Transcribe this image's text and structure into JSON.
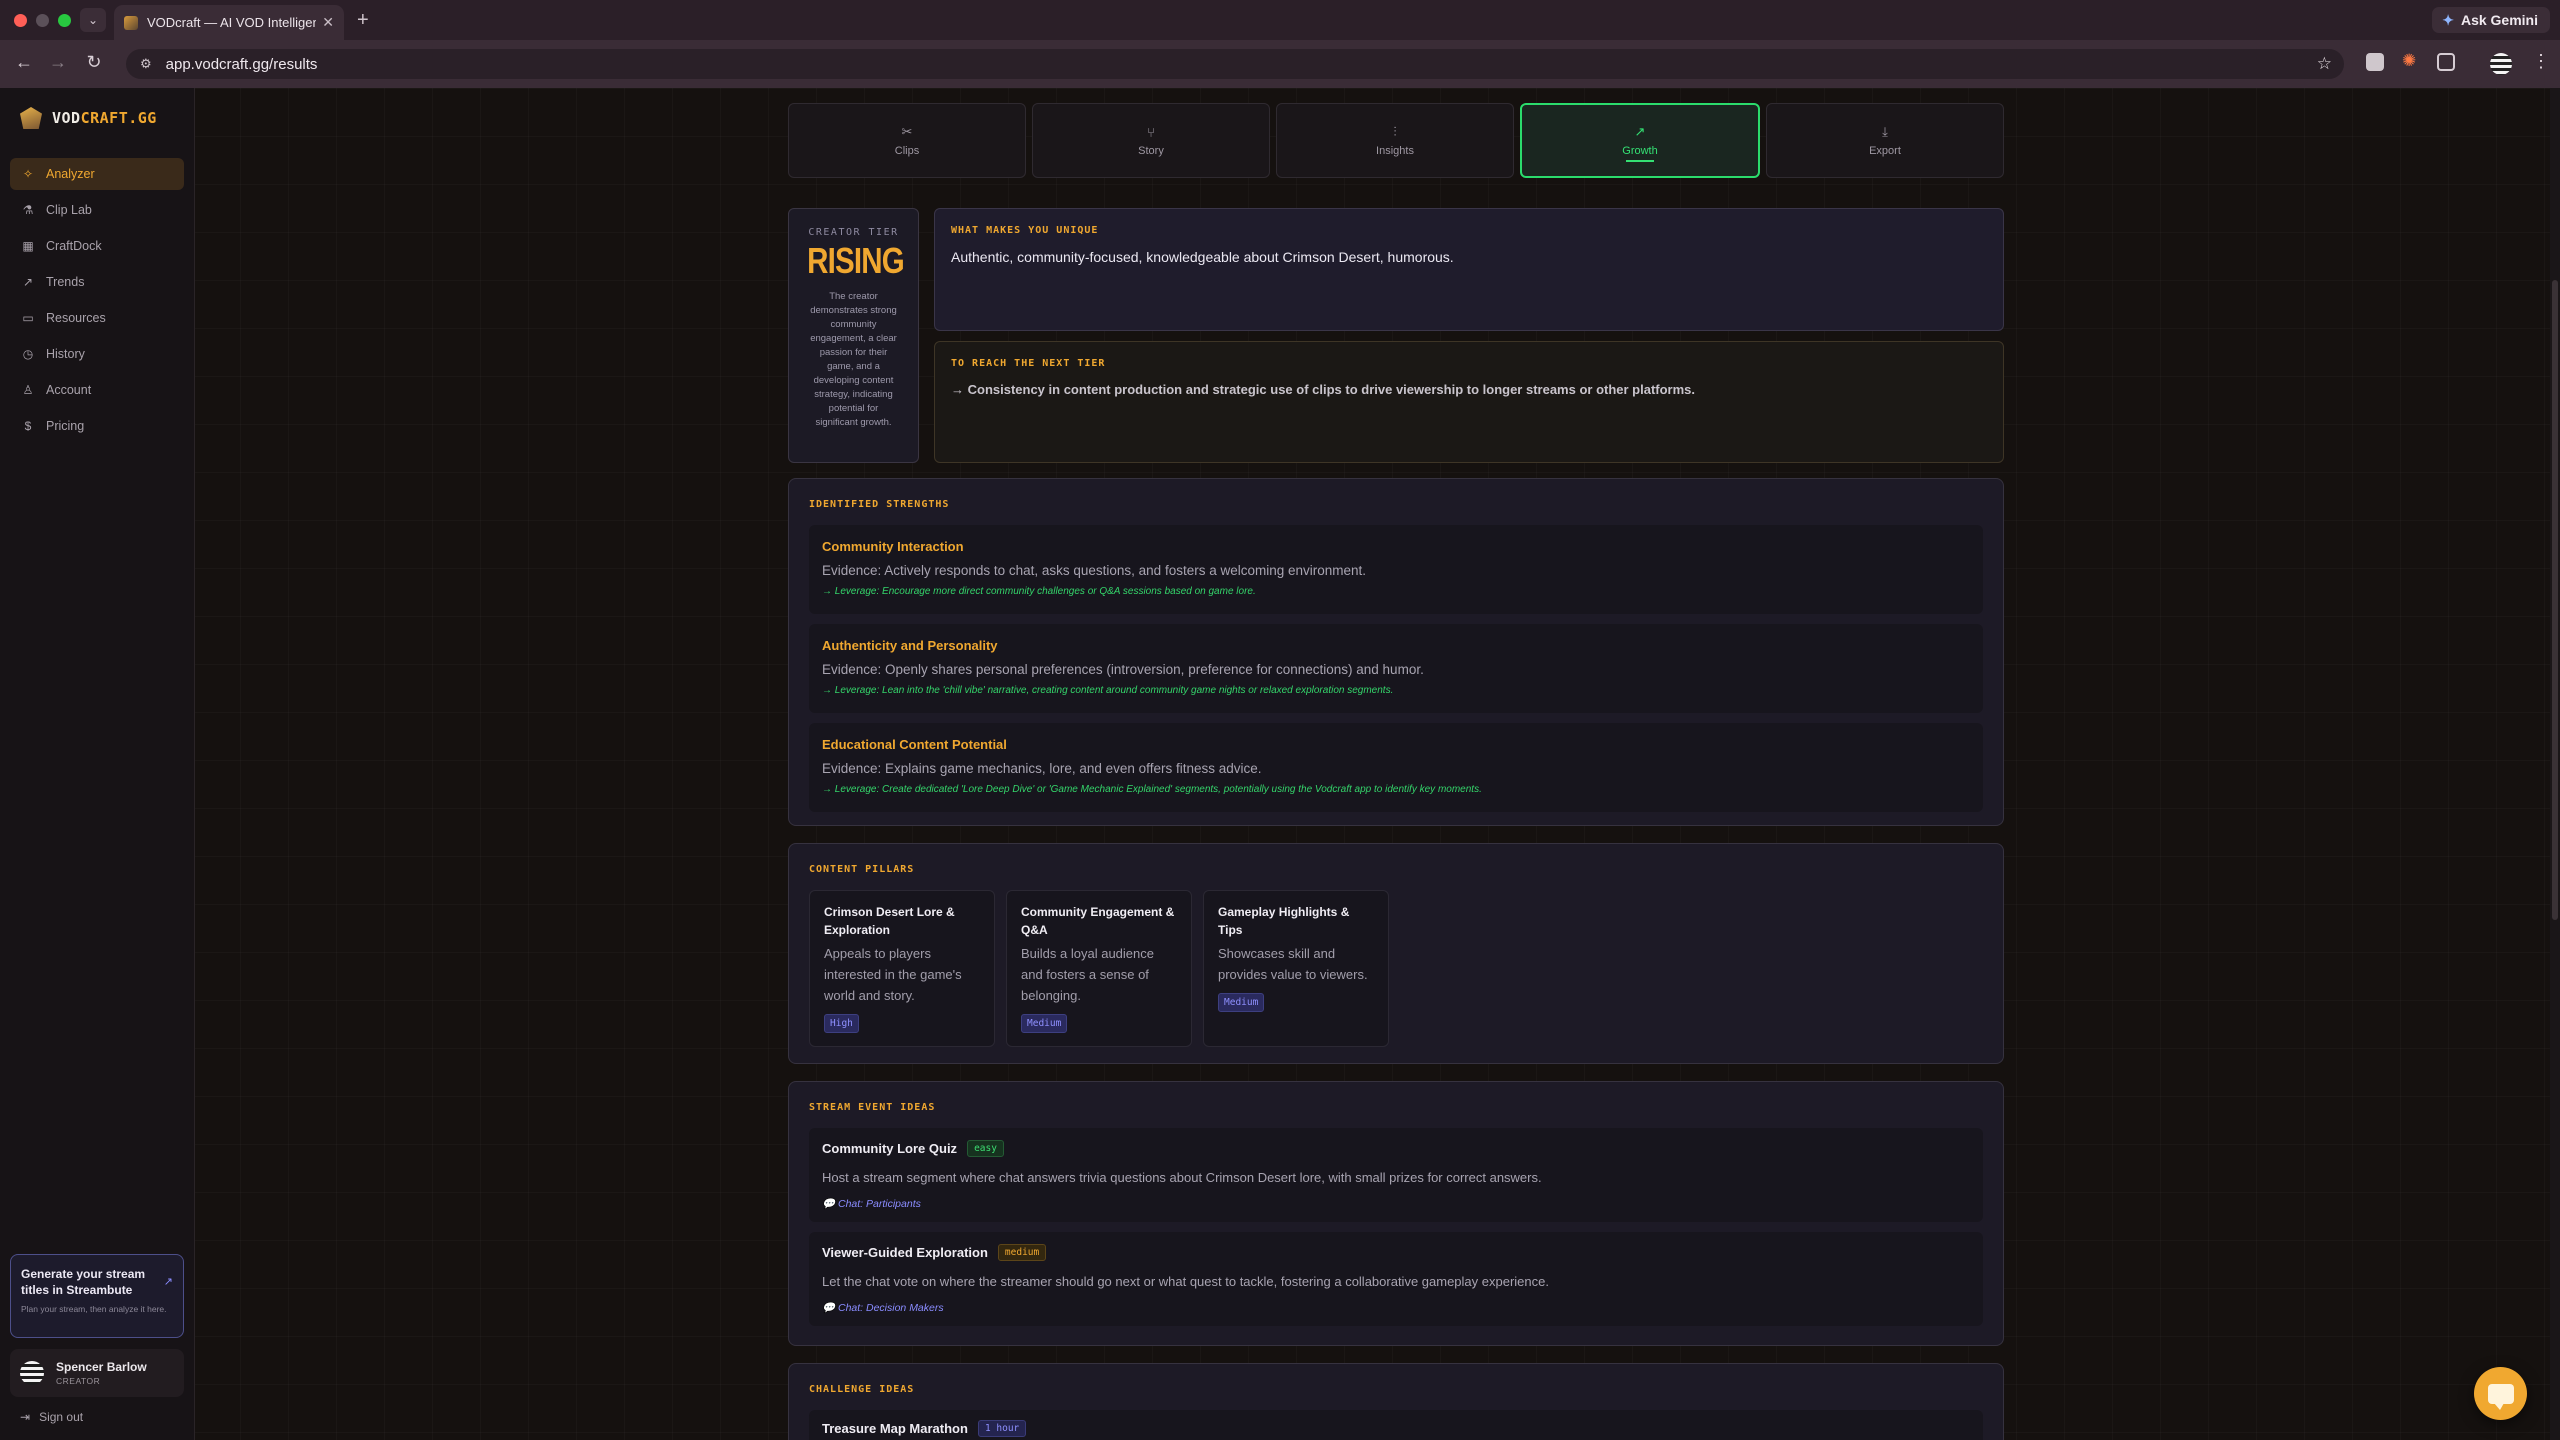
{
  "browser": {
    "tab_title": "VODcraft — AI VOD Intelligence",
    "url": "app.vodcraft.gg/results",
    "ask_gemini": "Ask Gemini"
  },
  "brand": {
    "logo_main": "VOD",
    "logo_accent": "CRAFT.GG"
  },
  "nav": [
    {
      "label": "Analyzer",
      "icon": "sparkle-icon"
    },
    {
      "label": "Clip Lab",
      "icon": "flask-icon"
    },
    {
      "label": "CraftDock",
      "icon": "grid-icon"
    },
    {
      "label": "Trends",
      "icon": "trending-icon"
    },
    {
      "label": "Resources",
      "icon": "folder-icon"
    },
    {
      "label": "History",
      "icon": "clock-icon"
    },
    {
      "label": "Account",
      "icon": "user-icon"
    },
    {
      "label": "Pricing",
      "icon": "dollar-icon"
    }
  ],
  "promo": {
    "title": "Generate your stream titles in Streambute",
    "subtitle": "Plan your stream, then analyze it here."
  },
  "user": {
    "name": "Spencer Barlow",
    "role": "CREATOR",
    "sign_out": "Sign out"
  },
  "tabs": [
    {
      "label": "Clips",
      "icon": "scissors-icon"
    },
    {
      "label": "Story",
      "icon": "branch-icon"
    },
    {
      "label": "Insights",
      "icon": "bar-chart-icon"
    },
    {
      "label": "Growth",
      "icon": "trend-up-icon"
    },
    {
      "label": "Export",
      "icon": "download-icon"
    }
  ],
  "tier": {
    "label": "CREATOR TIER",
    "value": "RISING",
    "description": "The creator demonstrates strong community engagement, a clear passion for their game, and a developing content strategy, indicating potential for significant growth."
  },
  "unique": {
    "label": "WHAT MAKES YOU UNIQUE",
    "text": "Authentic, community-focused, knowledgeable about Crimson Desert, humorous."
  },
  "next_tier": {
    "label": "TO REACH THE NEXT TIER",
    "text": "→ Consistency in content production and strategic use of clips to drive viewership to longer streams or other platforms."
  },
  "strengths": {
    "label": "IDENTIFIED STRENGTHS",
    "items": [
      {
        "title": "Community Interaction",
        "evidence": "Evidence: Actively responds to chat, asks questions, and fosters a welcoming environment.",
        "leverage": "→ Leverage: Encourage more direct community challenges or Q&A sessions based on game lore."
      },
      {
        "title": "Authenticity and Personality",
        "evidence": "Evidence: Openly shares personal preferences (introversion, preference for connections) and humor.",
        "leverage": "→ Leverage: Lean into the 'chill vibe' narrative, creating content around community game nights or relaxed exploration segments."
      },
      {
        "title": "Educational Content Potential",
        "evidence": "Evidence: Explains game mechanics, lore, and even offers fitness advice.",
        "leverage": "→ Leverage: Create dedicated 'Lore Deep Dive' or 'Game Mechanic Explained' segments, potentially using the Vodcraft app to identify key moments."
      }
    ]
  },
  "pillars": {
    "label": "CONTENT PILLARS",
    "items": [
      {
        "title": "Crimson Desert Lore & Exploration",
        "description": "Appeals to players interested in the game's world and story.",
        "priority": "High"
      },
      {
        "title": "Community Engagement & Q&A",
        "description": "Builds a loyal audience and fosters a sense of belonging.",
        "priority": "Medium"
      },
      {
        "title": "Gameplay Highlights & Tips",
        "description": "Showcases skill and provides value to viewers.",
        "priority": "Medium"
      }
    ]
  },
  "events": {
    "label": "STREAM EVENT IDEAS",
    "items": [
      {
        "title": "Community Lore Quiz",
        "difficulty": "easy",
        "description": "Host a stream segment where chat answers trivia questions about Crimson Desert lore, with small prizes for correct answers.",
        "chat": "💬 Chat: Participants"
      },
      {
        "title": "Viewer-Guided Exploration",
        "difficulty": "medium",
        "description": "Let the chat vote on where the streamer should go next or what quest to tackle, fostering a collaborative gameplay experience.",
        "chat": "💬 Chat: Decision Makers"
      }
    ]
  },
  "challenges": {
    "label": "CHALLENGE IDEAS",
    "items": [
      {
        "title": "Treasure Map Marathon",
        "duration": "1 hour"
      }
    ]
  }
}
